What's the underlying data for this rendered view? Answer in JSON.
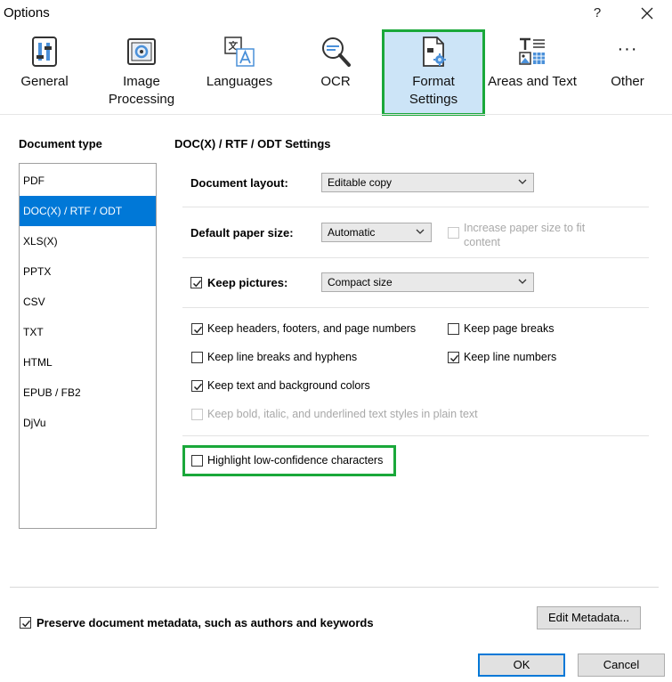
{
  "window": {
    "title": "Options",
    "help": "?",
    "close": "✕"
  },
  "toolbar": {
    "items": [
      {
        "icon": "general-icon",
        "label": "General"
      },
      {
        "icon": "image-processing-icon",
        "label": "Image\nProcessing"
      },
      {
        "icon": "languages-icon",
        "label": "Languages"
      },
      {
        "icon": "ocr-icon",
        "label": "OCR"
      },
      {
        "icon": "format-settings-icon",
        "label": "Format\nSettings",
        "selected": true
      },
      {
        "icon": "areas-and-text-icon",
        "label": "Areas and Text"
      },
      {
        "icon": "more-icon",
        "glyph": "···",
        "label": "Other"
      }
    ]
  },
  "document_type": {
    "heading": "Document type",
    "items": [
      "PDF",
      "DOC(X) / RTF / ODT",
      "XLS(X)",
      "PPTX",
      "CSV",
      "TXT",
      "HTML",
      "EPUB / FB2",
      "DjVu"
    ],
    "selected_index": 1
  },
  "settings": {
    "heading": "DOC(X) / RTF / ODT Settings",
    "document_layout": {
      "label": "Document layout:",
      "value": "Editable copy"
    },
    "paper_size": {
      "label": "Default paper size:",
      "value": "Automatic",
      "increase_label": "Increase paper size to fit content",
      "increase_checked": false,
      "increase_enabled": false
    },
    "keep_pictures": {
      "label": "Keep pictures:",
      "checked": true,
      "value": "Compact size"
    },
    "options": {
      "headers_footers": {
        "label": "Keep headers, footers, and page numbers",
        "checked": true
      },
      "page_breaks": {
        "label": "Keep page breaks",
        "checked": false
      },
      "line_breaks": {
        "label": "Keep line breaks and hyphens",
        "checked": false
      },
      "line_numbers": {
        "label": "Keep line numbers",
        "checked": true
      },
      "text_colors": {
        "label": "Keep text and background colors",
        "checked": true
      },
      "bold_italic": {
        "label": "Keep bold, italic, and underlined text styles in plain text",
        "checked": false,
        "enabled": false
      }
    },
    "highlight": {
      "label": "Highlight low-confidence characters",
      "checked": false
    }
  },
  "footer": {
    "metadata_label": "Preserve document metadata, such as authors and keywords",
    "metadata_checked": true,
    "edit_metadata": "Edit Metadata...",
    "ok": "OK",
    "cancel": "Cancel"
  },
  "colors": {
    "highlight_frame": "#1aa83a",
    "selection": "#0078d7",
    "toolbar_selected": "#cce4f7"
  }
}
